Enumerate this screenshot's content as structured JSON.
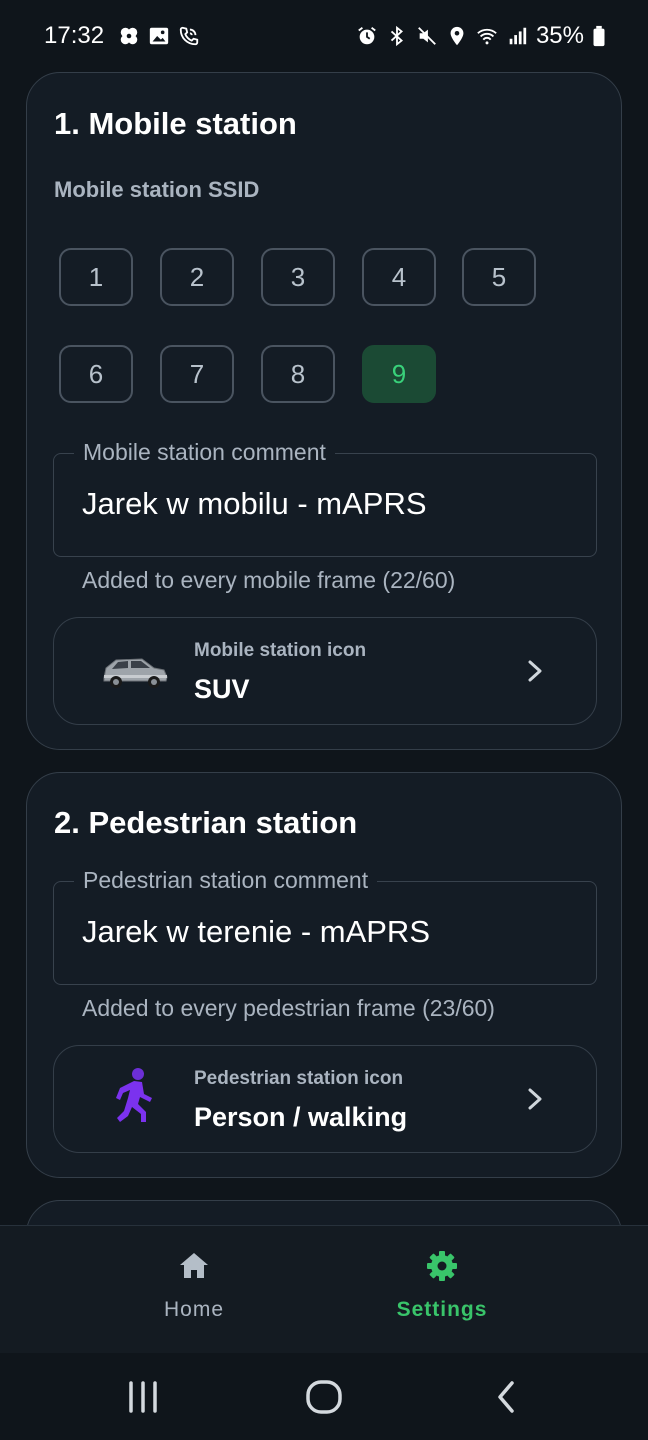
{
  "status_bar": {
    "time": "17:32",
    "battery": "35%",
    "left_icons": [
      "pinwheel-icon",
      "image-icon",
      "wifi-call-icon"
    ],
    "right_icons": [
      "alarm-icon",
      "bluetooth-icon",
      "mute-icon",
      "location-icon",
      "wifi-icon",
      "signal-icon",
      "battery-icon"
    ]
  },
  "mobile_section": {
    "title": "1. Mobile station",
    "ssid_label": "Mobile station SSID",
    "ssid_options": [
      "1",
      "2",
      "3",
      "4",
      "5",
      "6",
      "7",
      "8",
      "9"
    ],
    "ssid_selected": "9",
    "comment_label": "Mobile station comment",
    "comment_value": "Jarek w mobilu - mAPRS",
    "comment_helper": "Added to every mobile frame (22/60)",
    "icon_label": "Mobile station icon",
    "icon_value": "SUV",
    "icon_name": "suv-car-icon"
  },
  "pedestrian_section": {
    "title": "2. Pedestrian station",
    "comment_label": "Pedestrian station comment",
    "comment_value": "Jarek w terenie - mAPRS",
    "comment_helper": "Added to every pedestrian frame (23/60)",
    "icon_label": "Pedestrian station icon",
    "icon_value": "Person / walking",
    "icon_name": "person-walking-icon"
  },
  "bottom_nav": {
    "items": [
      {
        "label": "Home",
        "icon": "home-icon",
        "active": false
      },
      {
        "label": "Settings",
        "icon": "gear-icon",
        "active": true
      }
    ],
    "active_color": "#39c46a",
    "inactive_color": "#aab4c0"
  },
  "system_nav": {
    "buttons": [
      "recents-icon",
      "home-circle-icon",
      "back-icon"
    ]
  }
}
